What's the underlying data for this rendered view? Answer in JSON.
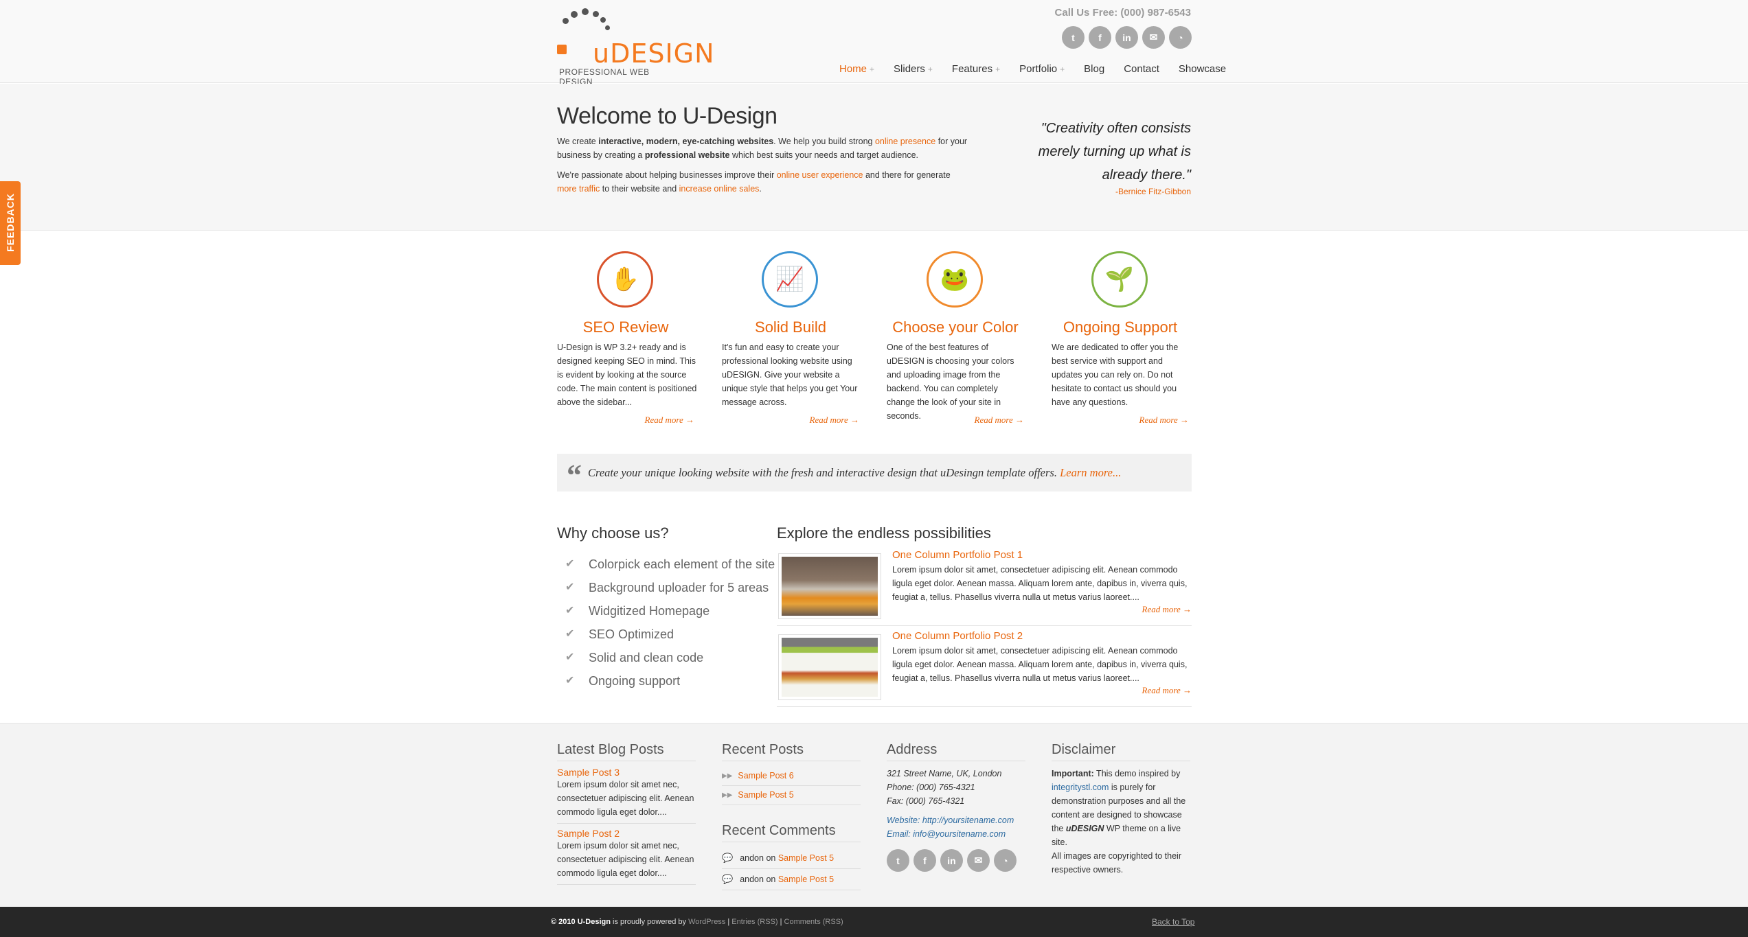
{
  "header": {
    "logo_text": "uDESIGN",
    "logo_tagline": "PROFESSIONAL WEB DESIGN",
    "call_us": "Call Us Free: (000) 987-6543",
    "social": [
      "twitter-icon",
      "facebook-icon",
      "linkedin-icon",
      "email-icon",
      "rss-icon"
    ],
    "nav": [
      {
        "label": "Home",
        "has_sub": true,
        "active": true
      },
      {
        "label": "Sliders",
        "has_sub": true
      },
      {
        "label": "Features",
        "has_sub": true
      },
      {
        "label": "Portfolio",
        "has_sub": true
      },
      {
        "label": "Blog",
        "has_sub": false
      },
      {
        "label": "Contact",
        "has_sub": false
      },
      {
        "label": "Showcase",
        "has_sub": false
      }
    ]
  },
  "welcome": {
    "title": "Welcome to U-Design",
    "quote": "\"Creativity often consists merely turning up what is already there.\"",
    "quote_author": "-Bernice Fitz-Gibbon"
  },
  "feedback_label": "FEEDBACK",
  "features": [
    {
      "title": "SEO Review",
      "text": "U-Design is WP 3.2+ ready and is designed keeping SEO in mind. This is evident by looking at the source code. The main content is positioned above the sidebar...",
      "more": "Read more →",
      "icon": "seo-icon"
    },
    {
      "title": "Solid Build",
      "text": "It's fun and easy to create your professional looking website using uDESIGN. Give your website a unique style that helps you get Your message across.",
      "more": "Read more →",
      "icon": "chart-icon"
    },
    {
      "title": "Choose your Color",
      "text": "One of the best features of uDESIGN is choosing your colors and uploading image from the backend. You can completely change the look of your site in seconds.",
      "more": "Read more →",
      "icon": "frog-icon"
    },
    {
      "title": "Ongoing Support",
      "text": "We are dedicated to offer you the best service with support and updates you can rely on. Do not hesitate to contact us should you have any questions.",
      "more": "Read more →",
      "icon": "plant-icon"
    }
  ],
  "callout": {
    "text": "Create your unique looking website with the fresh and interactive design that uDesingn template offers.",
    "link": "Learn more..."
  },
  "why": {
    "title": "Why choose us?",
    "items": [
      "Colorpick each element of the site",
      "Background uploader for 5 areas",
      "Widgitized Homepage",
      "SEO Optimized",
      "Solid and clean code",
      "Ongoing support"
    ]
  },
  "explore": {
    "title": "Explore the endless possibilities",
    "posts": [
      {
        "title": "One Column Portfolio Post 1",
        "text": "Lorem ipsum dolor sit amet, consectetuer adipiscing elit. Aenean commodo ligula eget dolor. Aenean massa. Aliquam lorem ante, dapibus in, viverra quis, feugiat a, tellus. Phasellus viverra nulla ut metus varius laoreet....",
        "more": "Read more →"
      },
      {
        "title": "One Column Portfolio Post 2",
        "text": "Lorem ipsum dolor sit amet, consectetuer adipiscing elit. Aenean commodo ligula eget dolor. Aenean massa. Aliquam lorem ante, dapibus in, viverra quis, feugiat a, tellus. Phasellus viverra nulla ut metus varius laoreet....",
        "more": "Read more →"
      }
    ]
  },
  "bottom": {
    "blog": {
      "title": "Latest Blog Posts",
      "posts": [
        {
          "title": "Sample Post 3",
          "text": "Lorem ipsum dolor sit amet nec, consectetuer adipiscing elit. Aenean commodo ligula eget dolor...."
        },
        {
          "title": "Sample Post 2",
          "text": "Lorem ipsum dolor sit amet nec, consectetuer adipiscing elit. Aenean commodo ligula eget dolor...."
        }
      ]
    },
    "recent_posts": {
      "title": "Recent Posts",
      "items": [
        "Sample Post 6",
        "Sample Post 5"
      ]
    },
    "recent_comments": {
      "title": "Recent Comments",
      "items": [
        {
          "author": "andon",
          "on": "on",
          "post": "Sample Post 5"
        },
        {
          "author": "andon",
          "on": "on",
          "post": "Sample Post 5"
        }
      ]
    },
    "address": {
      "title": "Address",
      "street": "321 Street Name, UK, London",
      "phone": "Phone: (000) 765-4321",
      "fax": "Fax: (000) 765-4321",
      "website": "Website: http://yoursitename.com",
      "email": "Email: info@yoursitename.com"
    },
    "disclaimer": {
      "title": "Disclaimer",
      "important": "Important:",
      "t1": " This demo inspired by ",
      "link": "integritystl.com",
      "t2": " is purely for demonstration purposes and all the content are designed to showcase the ",
      "brand": "uDESIGN",
      "t3": " WP theme on a live site.",
      "t4": "All images are copyrighted to their respective owners."
    }
  },
  "footer": {
    "copy": "© 2010 ",
    "site": "U-Design",
    "powered": " is proudly powered by ",
    "wp": "WordPress",
    "entries": "Entries (RSS)",
    "comments": "Comments (RSS)",
    "back_to_top": "Back to Top"
  },
  "colors": {
    "accent": "#e8650c",
    "footer_bg": "#272727",
    "link_blue": "#2c6aa0"
  }
}
